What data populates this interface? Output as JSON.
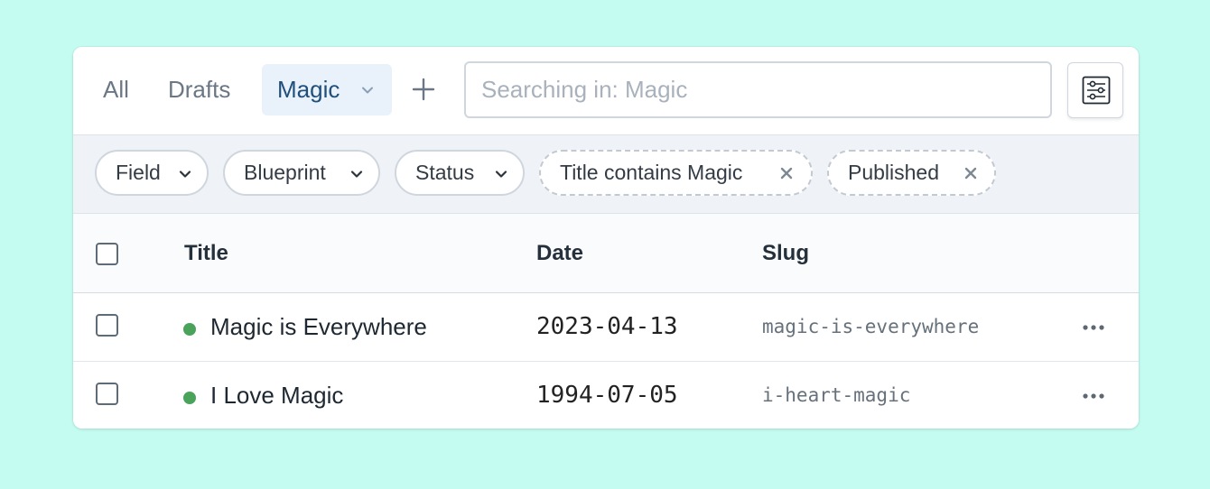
{
  "tabs": {
    "all": "All",
    "drafts": "Drafts",
    "active": "Magic"
  },
  "search": {
    "placeholder": "Searching in: Magic"
  },
  "filters": {
    "field": "Field",
    "blueprint": "Blueprint",
    "status": "Status",
    "title_contains": "Title contains Magic",
    "published": "Published"
  },
  "table": {
    "columns": {
      "title": "Title",
      "date": "Date",
      "slug": "Slug"
    },
    "rows": [
      {
        "title": "Magic is Everywhere",
        "date": "2023-04-13",
        "slug": "magic-is-everywhere",
        "status": "published"
      },
      {
        "title": "I Love Magic",
        "date": "1994-07-05",
        "slug": "i-heart-magic",
        "status": "published"
      }
    ]
  },
  "icons": {
    "tab_dropdown": "chevron-down-icon",
    "add_tab": "plus-icon",
    "filter_settings": "sliders-icon",
    "pill_dropdown": "chevron-down-icon",
    "remove_filter": "close-icon",
    "row_actions": "more-horizontal-icon"
  },
  "colors": {
    "background": "#c4fcf1",
    "active_tab_bg": "#e9f1fb",
    "active_tab_text": "#1f4f7a",
    "status_published": "#4aa35b"
  }
}
